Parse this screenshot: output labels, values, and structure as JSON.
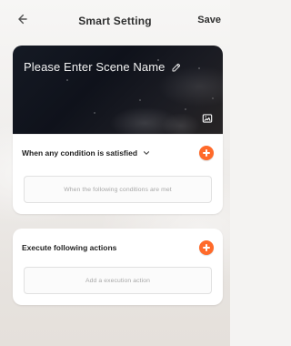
{
  "header": {
    "title": "Smart Setting",
    "save_label": "Save",
    "back_icon": "arrow-left-icon"
  },
  "scene": {
    "name_placeholder": "Please Enter Scene Name",
    "edit_icon": "pencil-icon",
    "image_icon": "image-icon"
  },
  "condition": {
    "title": "When any condition is satisfied",
    "dropdown_icon": "chevron-down-icon",
    "add_icon": "plus-circle-icon",
    "placeholder": "When the following conditions are met"
  },
  "actions": {
    "title": "Execute following actions",
    "add_icon": "plus-circle-icon",
    "placeholder": "Add a execution action"
  },
  "colors": {
    "accent": "#ff6a2a"
  }
}
